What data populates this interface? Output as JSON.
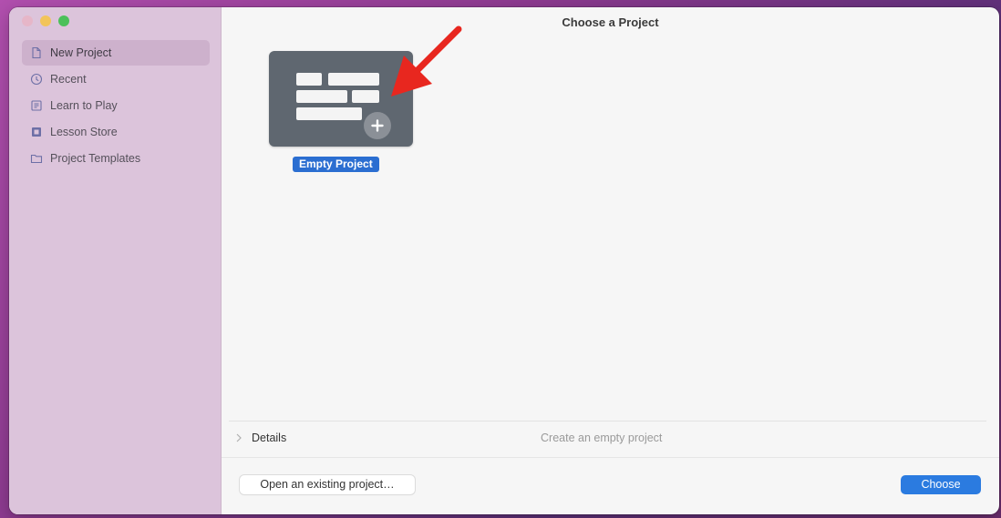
{
  "window": {
    "title": "Choose a Project"
  },
  "sidebar": {
    "items": [
      {
        "label": "New Project",
        "icon": "document-icon",
        "active": true
      },
      {
        "label": "Recent",
        "icon": "clock-icon",
        "active": false
      },
      {
        "label": "Learn to Play",
        "icon": "book-icon",
        "active": false
      },
      {
        "label": "Lesson Store",
        "icon": "store-icon",
        "active": false
      },
      {
        "label": "Project Templates",
        "icon": "folder-icon",
        "active": false
      }
    ]
  },
  "main": {
    "template": {
      "label": "Empty Project",
      "icon": "empty-project-tile-icon",
      "badge_icon": "plus-icon",
      "selected": true
    },
    "annotation": {
      "icon": "red-arrow-icon",
      "color": "#e8271f"
    },
    "details": {
      "label": "Details",
      "description": "Create an empty project"
    }
  },
  "footer": {
    "open_label": "Open an existing project…",
    "choose_label": "Choose"
  },
  "colors": {
    "accent": "#2b7be0",
    "selection": "#2b6ed1",
    "sidebar_bg": "#dcc4db"
  }
}
